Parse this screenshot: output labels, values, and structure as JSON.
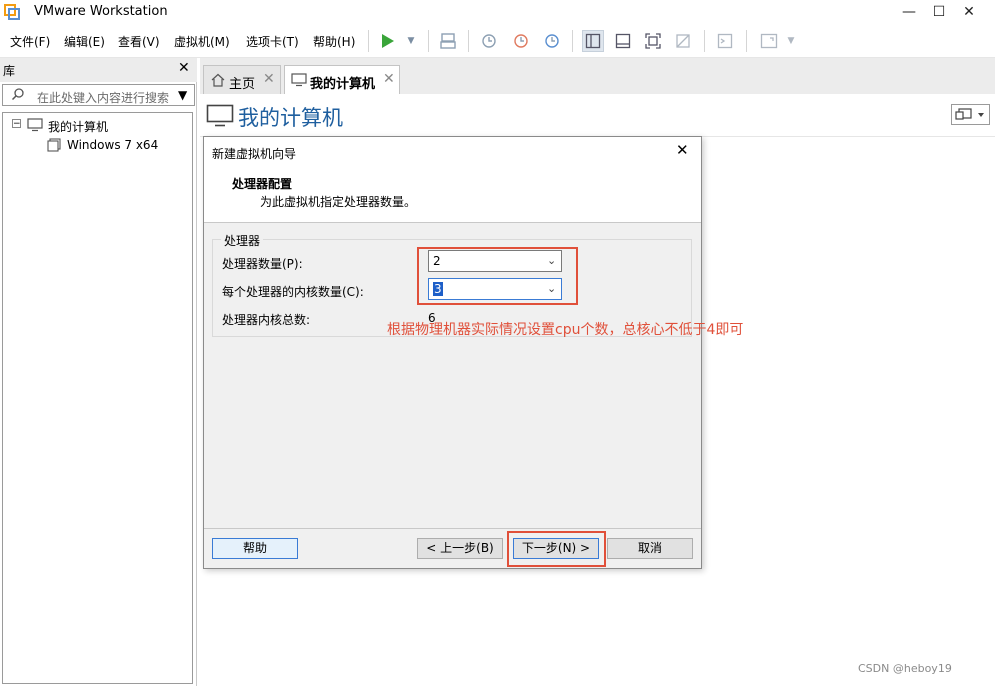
{
  "window": {
    "title": "VMware Workstation",
    "minimize": "—",
    "maximize": "☐",
    "close": "✕"
  },
  "menu": {
    "items": [
      "文件(F)",
      "编辑(E)",
      "查看(V)",
      "虚拟机(M)",
      "选项卡(T)",
      "帮助(H)"
    ]
  },
  "library": {
    "title": "库",
    "close": "✕",
    "search_placeholder": "在此处键入内容进行搜索",
    "search_dropdown": "▼",
    "tree": {
      "expander": "−",
      "root": "我的计算机",
      "vm": "Windows 7 x64"
    }
  },
  "tabs": {
    "home": "主页",
    "my_computer": "我的计算机",
    "close": "✕"
  },
  "main": {
    "page_title": "我的计算机"
  },
  "dialog": {
    "title": "新建虚拟机向导",
    "close": "✕",
    "heading": "处理器配置",
    "subheading": "为此虚拟机指定处理器数量。",
    "group_title": "处理器",
    "processor_count_label": "处理器数量(P):",
    "processor_count_value": "2",
    "cores_label": "每个处理器的内核数量(C):",
    "cores_value": "3",
    "total_label": "处理器内核总数:",
    "total_value": "6",
    "buttons": {
      "help": "帮助",
      "back": "< 上一步(B)",
      "next": "下一步(N) >",
      "cancel": "取消"
    }
  },
  "annotation": {
    "text": "根据物理机器实际情况设置cpu个数，总核心不低于4即可",
    "color": "#e0503a"
  },
  "watermark": "CSDN @heboy19",
  "colors": {
    "accent": "#1f5f9f",
    "play": "#3aa53a",
    "highlight": "#e0503a"
  }
}
